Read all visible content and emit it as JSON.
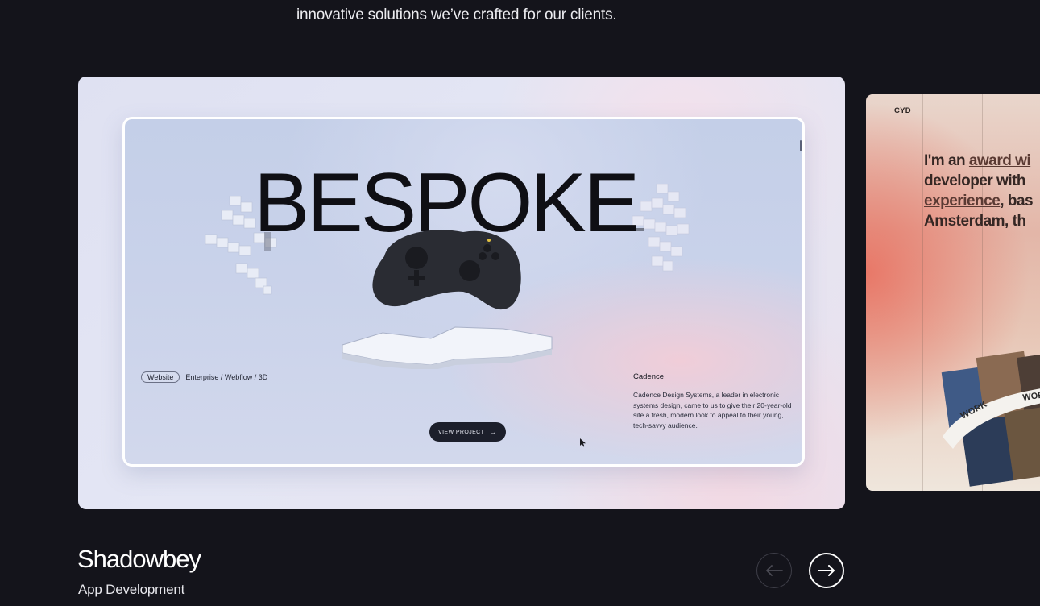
{
  "intro_text": "innovative solutions we’ve crafted for our clients.",
  "featured_slide": {
    "headline": "BESPOKE",
    "tag": "Website",
    "tag_meta": "Enterprise / Webflow / 3D",
    "button_label": "VIEW PROJECT",
    "client_name": "Cadence",
    "client_description": "Cadence Design Systems, a leader in electronic systems design, came to us to give their 20-year-old site a fresh, modern look to appeal to their young, tech-savvy audience."
  },
  "next_slide": {
    "logo": "CYD",
    "lines": {
      "line1_a": "I'm an ",
      "line1_u": "award wi",
      "line2": "developer with",
      "line3_u": "experience",
      "line3_b": ", bas",
      "line4": "Amsterdam, th"
    },
    "ribbon_a": "WORK",
    "ribbon_b": "WORK"
  },
  "project": {
    "title": "Shadowbey",
    "category": "App Development"
  },
  "icons": {
    "prev": "arrow-left-icon",
    "next": "arrow-right-icon"
  },
  "colors": {
    "background": "#14141b",
    "accent": "#ffffff"
  }
}
